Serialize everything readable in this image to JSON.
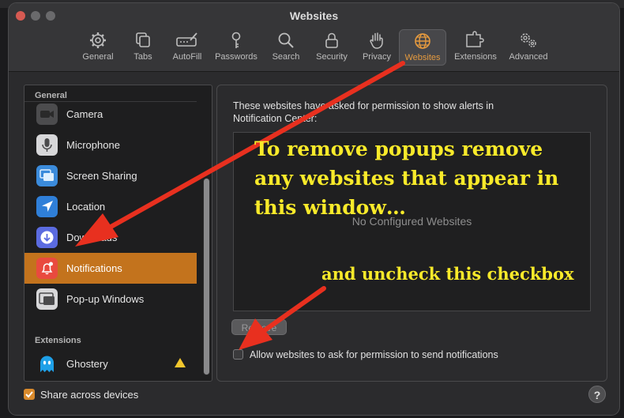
{
  "window": {
    "title": "Websites"
  },
  "toolbar": {
    "items": [
      {
        "label": "General",
        "icon": "gear-icon"
      },
      {
        "label": "Tabs",
        "icon": "tabs-icon"
      },
      {
        "label": "AutoFill",
        "icon": "autofill-icon"
      },
      {
        "label": "Passwords",
        "icon": "key-icon"
      },
      {
        "label": "Search",
        "icon": "search-icon"
      },
      {
        "label": "Security",
        "icon": "lock-icon"
      },
      {
        "label": "Privacy",
        "icon": "hand-icon"
      },
      {
        "label": "Websites",
        "icon": "globe-icon",
        "active": true
      },
      {
        "label": "Extensions",
        "icon": "puzzle-icon"
      },
      {
        "label": "Advanced",
        "icon": "gears-icon"
      }
    ]
  },
  "sidebar": {
    "general_header": "General",
    "extensions_header": "Extensions",
    "items": [
      {
        "label": "Camera",
        "icon": "camera-icon"
      },
      {
        "label": "Microphone",
        "icon": "microphone-icon"
      },
      {
        "label": "Screen Sharing",
        "icon": "screen-sharing-icon"
      },
      {
        "label": "Location",
        "icon": "location-icon"
      },
      {
        "label": "Downloads",
        "icon": "downloads-icon"
      },
      {
        "label": "Notifications",
        "icon": "notifications-bell-icon",
        "selected": true
      },
      {
        "label": "Pop-up Windows",
        "icon": "popup-windows-icon"
      }
    ],
    "extensions": [
      {
        "label": "Ghostery",
        "icon": "ghostery-icon",
        "warning": true
      }
    ]
  },
  "content": {
    "description": "These websites have asked for permission to show alerts in Notification Center:",
    "empty_text": "No Configured Websites",
    "remove_label": "Remove",
    "allow_checkbox_label": "Allow websites to ask for permission to send notifications",
    "allow_checked": false
  },
  "footer": {
    "share_label": "Share across devices",
    "share_checked": true,
    "help_label": "?"
  },
  "annotations": {
    "line1": "To remove popups remove",
    "line2": "any websites that appear in",
    "line3": "this window…",
    "line4": "and uncheck this checkbox"
  },
  "colors": {
    "accent": "#c3731d",
    "annotation_text": "#f8ea2a",
    "arrow": "#e8301f"
  }
}
